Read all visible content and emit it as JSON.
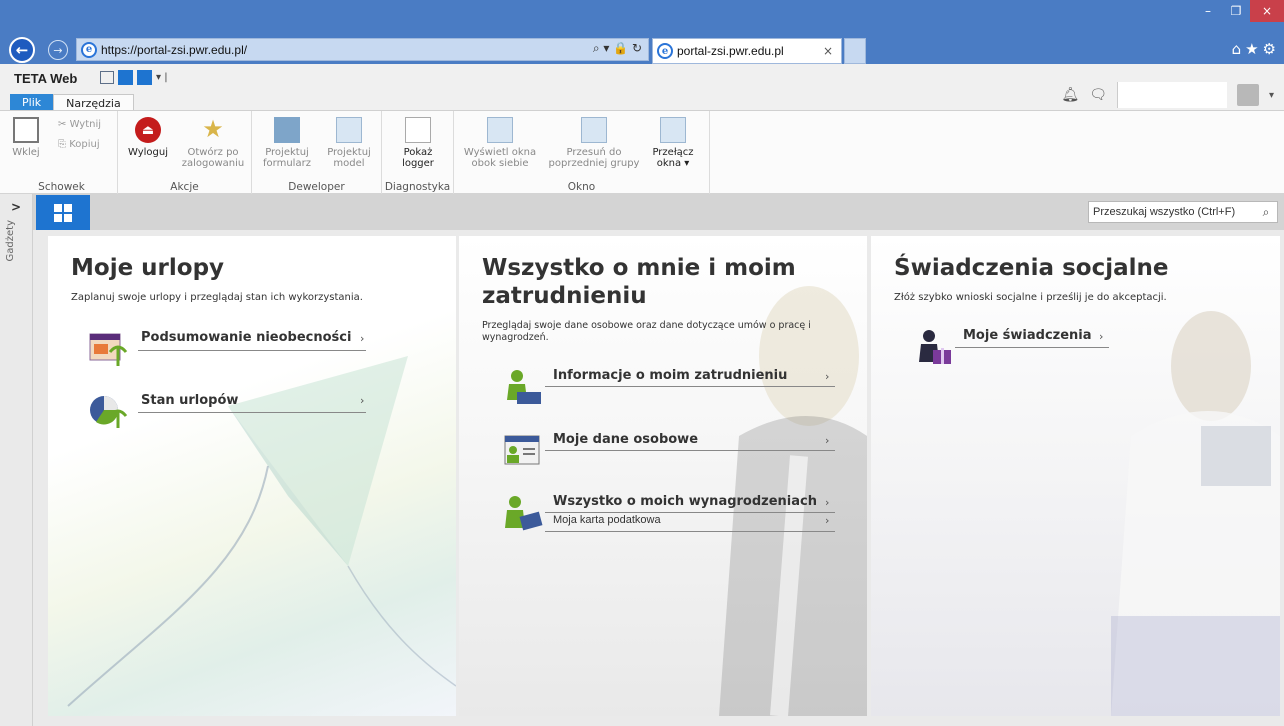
{
  "browser": {
    "url": "https://portal-zsi.pwr.edu.pl/",
    "tab_title": "portal-zsi.pwr.edu.pl",
    "window_controls": {
      "minimize": "–",
      "restore": "❐",
      "close": "×"
    },
    "tab_close": "×"
  },
  "app": {
    "title": "TETA Web",
    "ribbon_tabs": [
      "Plik",
      "Narzędzia"
    ]
  },
  "ribbon": {
    "schowek": {
      "label": "Schowek",
      "paste": "Wklej",
      "cut": "Wytnij",
      "copy": "Kopiuj"
    },
    "akcje": {
      "label": "Akcje",
      "logout": "Wyloguj",
      "open_after": "Otwórz po zalogowaniu"
    },
    "deweloper": {
      "label": "Deweloper",
      "design_form": "Projektuj formularz",
      "design_model": "Projektuj model"
    },
    "diagnostyka": {
      "label": "Diagnostyka",
      "show_logger": "Pokaż logger"
    },
    "okno": {
      "label": "Okno",
      "side_by_side": "Wyświetl okna obok siebie",
      "move_prev": "Przesuń do poprzedniej grupy",
      "switch": "Przełącz okna"
    }
  },
  "sidebar": {
    "label": "Gadżety"
  },
  "search": {
    "placeholder": "Przeszukaj wszystko (Ctrl+F)"
  },
  "panels": {
    "urlopy": {
      "title": "Moje urlopy",
      "desc": "Zaplanuj swoje urlopy i przeglądaj stan ich wykorzystania.",
      "links": [
        "Podsumowanie nieobecności",
        "Stan urlopów"
      ]
    },
    "zatrudnienie": {
      "title": "Wszystko o mnie i moim zatrudnieniu",
      "desc": "Przeglądaj swoje dane osobowe oraz dane dotyczące umów o pracę i wynagrodzeń.",
      "links": [
        "Informacje o moim zatrudnieniu",
        "Moje dane osobowe",
        "Wszystko o moich wynagrodzeniach"
      ],
      "sublink": "Moja karta podatkowa"
    },
    "swiadczenia": {
      "title": "Świadczenia socjalne",
      "desc": "Złóż szybko wnioski socjalne i prześlij je do akceptacji.",
      "links": [
        "Moje świadczenia"
      ]
    }
  },
  "colors": {
    "accent": "#1e74d0",
    "titlebar": "#4a7cc4",
    "close": "#c9404a"
  }
}
